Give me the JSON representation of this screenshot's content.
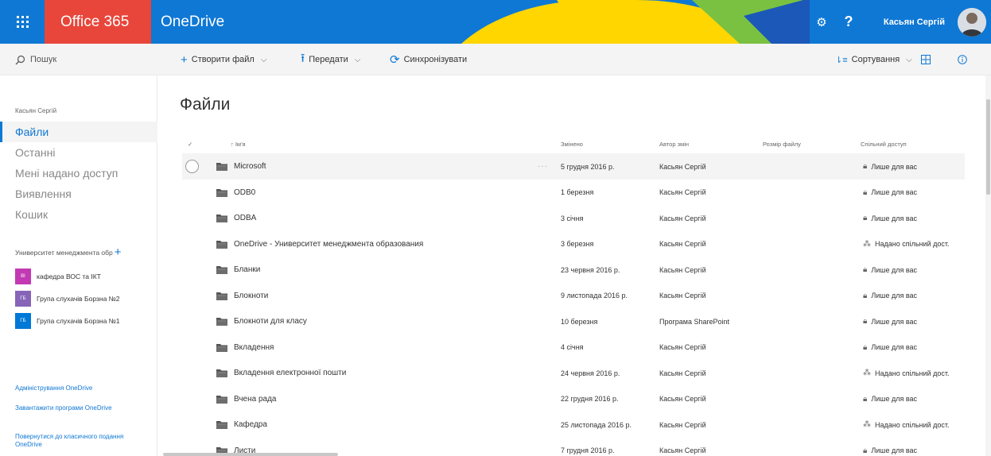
{
  "suite": {
    "brand": "Office 365",
    "app_name": "OneDrive",
    "settings_label": "⚙",
    "help_label": "?",
    "user_name": "Касьян Сергій",
    "colors": {
      "bar": "#0f78d4",
      "brand": "#e8463b",
      "yellow": "#ffd600",
      "green": "#7ac142"
    }
  },
  "commands": {
    "search": "Пошук",
    "create": "Створити файл",
    "upload": "Передати",
    "sync": "Синхронізувати",
    "sort": "Сортування"
  },
  "nav": {
    "user": "Касьян Сергій",
    "items": [
      {
        "label": "Файли",
        "active": true
      },
      {
        "label": "Останні"
      },
      {
        "label": "Мені надано доступ"
      },
      {
        "label": "Виявлення"
      },
      {
        "label": "Кошик"
      }
    ],
    "section_title": "Университет менеджмента обр",
    "groups": [
      {
        "initials": "ВІ",
        "label": "кафедра ВОС та ІКТ",
        "color": "#c239b3"
      },
      {
        "initials": "ГБ",
        "label": "Група слухачів Борзна №2",
        "color": "#8764b8"
      },
      {
        "initials": "ГБ",
        "label": "Група слухачів Борзна №1",
        "color": "#0078d7"
      }
    ],
    "links": [
      "Адміністрування OneDrive",
      "Завантажити програми OneDrive",
      "Повернутися до класичного подання OneDrive"
    ]
  },
  "main": {
    "title": "Файли",
    "columns": {
      "check": "✓",
      "name": "↑ Ім'я",
      "modified": "Змінено",
      "author": "Автор змін",
      "size": "Розмір файлу",
      "sharing": "Спільний доступ"
    },
    "rows": [
      {
        "name": "Microsoft",
        "modified": "5 грудня 2016 р.",
        "author": "Касьян Сергій",
        "sharing": "Лише для вас",
        "shared": false,
        "selected": true
      },
      {
        "name": "ODB0",
        "modified": "1 березня",
        "author": "Касьян Сергій",
        "sharing": "Лише для вас",
        "shared": false
      },
      {
        "name": "ODBA",
        "modified": "3 січня",
        "author": "Касьян Сергій",
        "sharing": "Лише для вас",
        "shared": false
      },
      {
        "name": "OneDrive - Университет менеджмента образования",
        "modified": "3 березня",
        "author": "Касьян Сергій",
        "sharing": "Надано спільний дост.",
        "shared": true
      },
      {
        "name": "Бланки",
        "modified": "23 червня 2016 р.",
        "author": "Касьян Сергій",
        "sharing": "Лише для вас",
        "shared": false
      },
      {
        "name": "Блокноти",
        "modified": "9 листопада 2016 р.",
        "author": "Касьян Сергій",
        "sharing": "Лише для вас",
        "shared": false
      },
      {
        "name": "Блокноти для класу",
        "modified": "10 березня",
        "author": "Програма SharePoint",
        "sharing": "Лише для вас",
        "shared": false
      },
      {
        "name": "Вкладення",
        "modified": "4 січня",
        "author": "Касьян Сергій",
        "sharing": "Лише для вас",
        "shared": false
      },
      {
        "name": "Вкладення електронної пошти",
        "modified": "24 червня 2016 р.",
        "author": "Касьян Сергій",
        "sharing": "Надано спільний дост.",
        "shared": true
      },
      {
        "name": "Вчена рада",
        "modified": "22 грудня 2016 р.",
        "author": "Касьян Сергій",
        "sharing": "Лише для вас",
        "shared": false
      },
      {
        "name": "Кафедра",
        "modified": "25 листопада 2016 р.",
        "author": "Касьян Сергій",
        "sharing": "Надано спільний дост.",
        "shared": true
      },
      {
        "name": "Листи",
        "modified": "7 грудня 2016 р.",
        "author": "Касьян Сергій",
        "sharing": "Лише для вас",
        "shared": false
      }
    ]
  }
}
